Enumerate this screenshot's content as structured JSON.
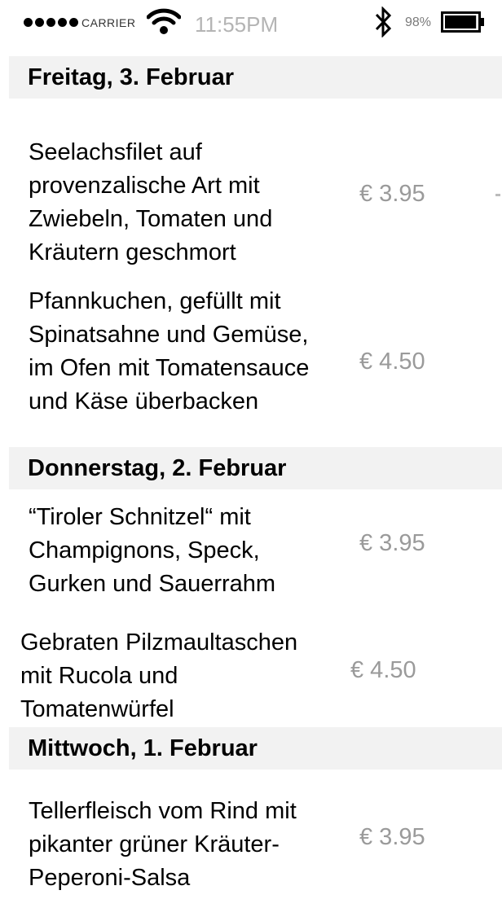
{
  "status_bar": {
    "carrier": "CARRIER",
    "time": "11:55PM",
    "battery_percent": "98%",
    "battery_level": 0.98,
    "icons": [
      "signal-dots",
      "wifi-icon",
      "bluetooth-icon",
      "battery-icon"
    ]
  },
  "days": [
    {
      "header": "Freitag, 3. Februar",
      "dishes": [
        {
          "lines": [
            "Seelachsfilet auf",
            "provenzalische Art mit",
            "Zwiebeln, Tomaten und",
            "Kräutern geschmort"
          ],
          "price": "€ 3.95"
        },
        {
          "lines": [
            "Pfannkuchen, gefüllt mit",
            "Spinatsahne und Gemüse,",
            "im Ofen mit Tomatensauce",
            "und Käse überbacken"
          ],
          "price": "€ 4.50"
        }
      ]
    },
    {
      "header": "Donnerstag, 2. Februar",
      "dishes": [
        {
          "lines": [
            "“Tiroler Schnitzel“ mit",
            "Champignons, Speck,",
            "Gurken und Sauerrahm"
          ],
          "price": "€ 3.95"
        },
        {
          "lines": [
            "Gebraten Pilzmaultaschen",
            "mit Rucola und",
            "Tomatenwürfel"
          ],
          "price": "€ 4.50"
        }
      ]
    },
    {
      "header": "Mittwoch, 1. Februar",
      "dishes": [
        {
          "lines": [
            "Tellerfleisch vom Rind mit",
            "pikanter grüner Kräuter-",
            "Peperoni-Salsa"
          ],
          "price": "€ 3.95"
        }
      ]
    }
  ]
}
